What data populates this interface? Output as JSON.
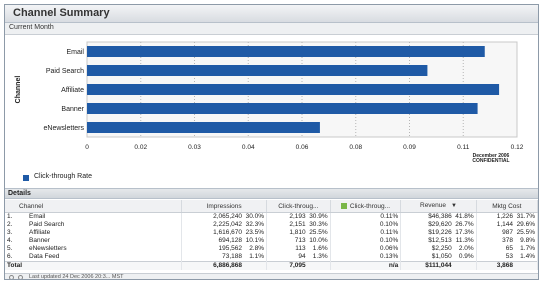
{
  "window": {
    "title": "Channel Summary",
    "subtitle": "Current Month"
  },
  "chart_data": {
    "type": "bar",
    "orientation": "horizontal",
    "categories": [
      "Email",
      "Paid Search",
      "Affiliate",
      "Banner",
      "eNewsletters"
    ],
    "values": [
      0.111,
      0.095,
      0.115,
      0.109,
      0.065
    ],
    "ylabel": "Channel",
    "xticks": [
      "0",
      "0.02",
      "0.03",
      "0.04",
      "0.06",
      "0.08",
      "0.09",
      "0.11",
      "0.12"
    ],
    "xlim": [
      0,
      0.12
    ],
    "legend": "bottom-left",
    "series": [
      {
        "name": "Click-through Rate",
        "color": "#1f5aa6"
      }
    ],
    "note_line1": "December 2006",
    "note_line2": "CONFIDENTIAL"
  },
  "legend": {
    "label": "Click-through Rate"
  },
  "details": {
    "title": "Details",
    "columns": {
      "channel": "Channel",
      "impressions": "Impressions",
      "clicks": "Click-throug...",
      "ctr": "Click-throug...",
      "revenue": "Revenue",
      "cost": "Mktg Cost"
    },
    "rows": [
      {
        "idx": "1.",
        "channel": "Email",
        "imp": "2,065,240",
        "imp_pct": "30.0%",
        "clk": "2,193",
        "clk_pct": "30.9%",
        "ctr": "0.11%",
        "rev": "$46,386",
        "rev_pct": "41.8%",
        "cost": "1,226",
        "cost_pct": "31.7%"
      },
      {
        "idx": "2.",
        "channel": "Paid Search",
        "imp": "2,225,042",
        "imp_pct": "32.3%",
        "clk": "2,151",
        "clk_pct": "30.3%",
        "ctr": "0.10%",
        "rev": "$29,620",
        "rev_pct": "26.7%",
        "cost": "1,144",
        "cost_pct": "29.6%"
      },
      {
        "idx": "3.",
        "channel": "Affiliate",
        "imp": "1,616,670",
        "imp_pct": "23.5%",
        "clk": "1,810",
        "clk_pct": "25.5%",
        "ctr": "0.11%",
        "rev": "$19,226",
        "rev_pct": "17.3%",
        "cost": "987",
        "cost_pct": "25.5%"
      },
      {
        "idx": "4.",
        "channel": "Banner",
        "imp": "694,128",
        "imp_pct": "10.1%",
        "clk": "713",
        "clk_pct": "10.0%",
        "ctr": "0.10%",
        "rev": "$12,513",
        "rev_pct": "11.3%",
        "cost": "378",
        "cost_pct": "9.8%"
      },
      {
        "idx": "5.",
        "channel": "eNewsletters",
        "imp": "195,562",
        "imp_pct": "2.8%",
        "clk": "113",
        "clk_pct": "1.6%",
        "ctr": "0.06%",
        "rev": "$2,250",
        "rev_pct": "2.0%",
        "cost": "65",
        "cost_pct": "1.7%"
      },
      {
        "idx": "6.",
        "channel": "Data Feed",
        "imp": "73,188",
        "imp_pct": "1.1%",
        "clk": "94",
        "clk_pct": "1.3%",
        "ctr": "0.13%",
        "rev": "$1,050",
        "rev_pct": "0.9%",
        "cost": "53",
        "cost_pct": "1.4%"
      }
    ],
    "total": {
      "label": "Total",
      "imp": "6,886,868",
      "clk": "7,095",
      "ctr": "n/a",
      "rev": "$111,044",
      "cost": "3,868"
    }
  },
  "footer": {
    "text": "Last updated 24 Dec 2006 20:3... MST"
  },
  "colors": {
    "bar": "#1f5aa6",
    "ctr_swatch": "#7ab648"
  },
  "icons": {
    "sort": "sort-desc-icon",
    "footer": [
      "refresh-icon",
      "info-icon"
    ]
  }
}
